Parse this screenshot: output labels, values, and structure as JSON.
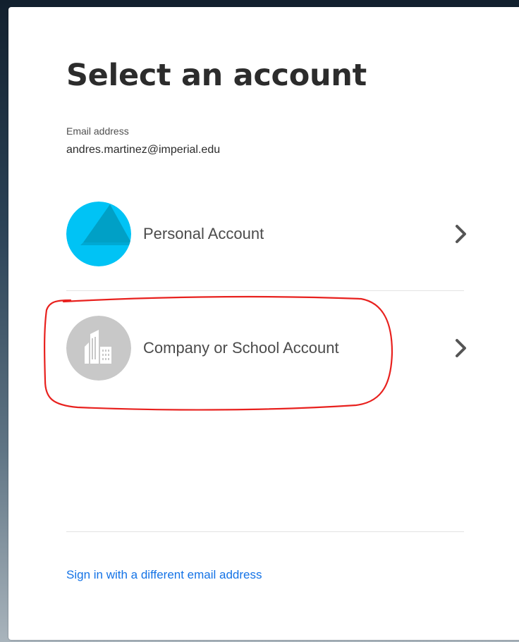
{
  "page": {
    "title": "Select an account",
    "email_label": "Email address",
    "email_value": "andres.martinez@imperial.edu"
  },
  "accounts": [
    {
      "label": "Personal Account",
      "icon": "personal-account-icon",
      "color": "#00c3f5"
    },
    {
      "label": "Company or School Account",
      "icon": "building-icon",
      "color": "#c8c8c8"
    }
  ],
  "footer": {
    "different_email_link": "Sign in with a different email address"
  },
  "colors": {
    "link": "#1473e6",
    "annotation": "#e8211e"
  }
}
